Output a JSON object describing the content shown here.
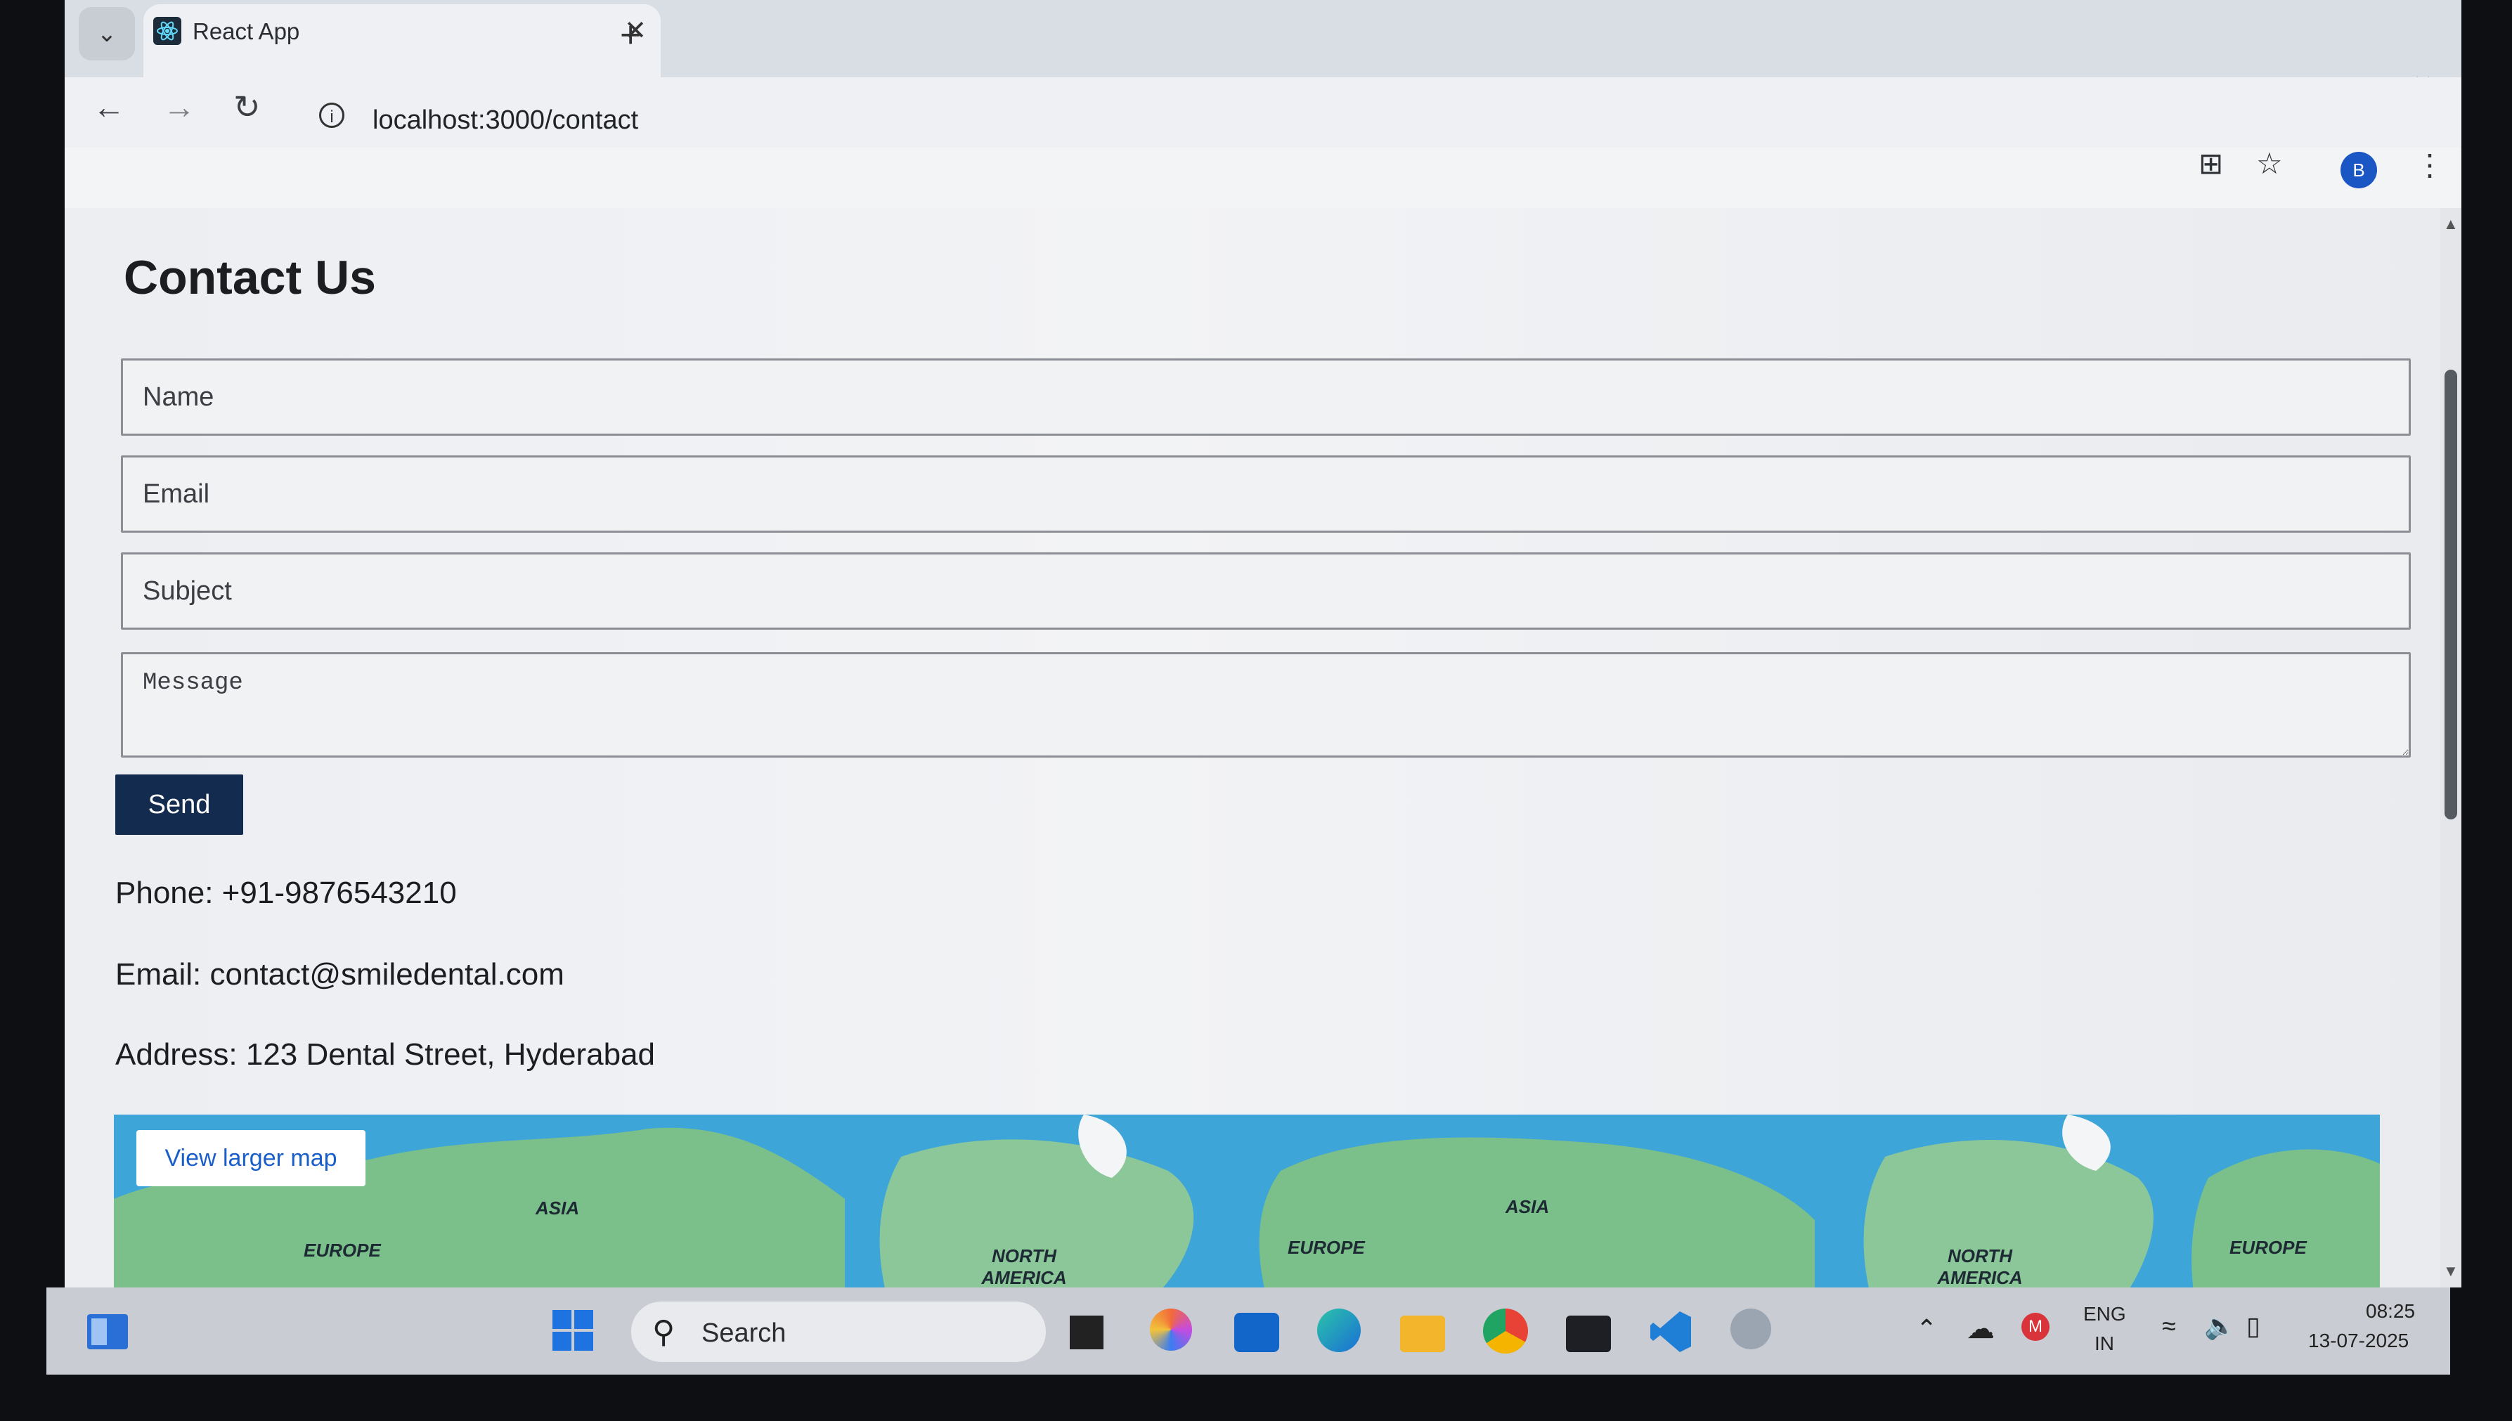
{
  "browser": {
    "tab_title": "React App",
    "url": "localhost:3000/contact",
    "profile_initial": "B",
    "icons": [
      "back-icon",
      "forward-icon",
      "reload-icon",
      "site-info-icon",
      "install-icon",
      "bookmark-star-icon",
      "menu-kebab-icon"
    ]
  },
  "page": {
    "title": "Contact Us",
    "form": {
      "name_placeholder": "Name",
      "email_placeholder": "Email",
      "subject_placeholder": "Subject",
      "message_placeholder": "Message",
      "send_label": "Send"
    },
    "contact": {
      "phone": "Phone: +91-9876543210",
      "email": "Email: contact@smiledental.com",
      "address": "Address: 123 Dental Street, Hyderabad"
    },
    "map": {
      "view_larger": "View larger map",
      "labels": [
        "ASIA",
        "EUROPE",
        "NORTH AMERICA",
        "EUROPE",
        "ASIA",
        "NORTH AMERICA",
        "EUROPE"
      ]
    }
  },
  "taskbar": {
    "search_label": "Search",
    "language": "ENG",
    "region": "IN",
    "time": "08:25",
    "date": "13-07-2025"
  },
  "colors": {
    "send_button": "#132b4f",
    "map_water": "#3da5d8",
    "map_land": "#7bbf8a",
    "map_link": "#1a5fc9"
  }
}
